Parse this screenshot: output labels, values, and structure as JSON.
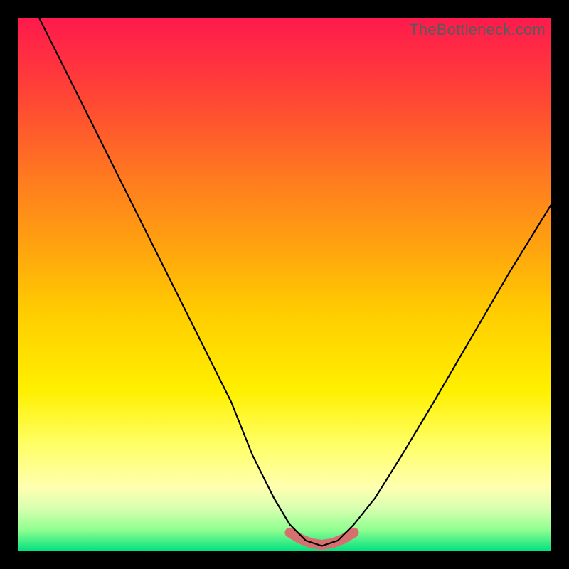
{
  "watermark": "TheBottleneck.com",
  "chart_data": {
    "type": "line",
    "title": "",
    "xlabel": "",
    "ylabel": "",
    "xlim": [
      0,
      100
    ],
    "ylim": [
      0,
      100
    ],
    "series": [
      {
        "name": "bottleneck-curve",
        "x": [
          4,
          10,
          16,
          22,
          28,
          34,
          40,
          44,
          48,
          51,
          54,
          57,
          60,
          63,
          67,
          72,
          78,
          85,
          92,
          100
        ],
        "values": [
          100,
          88,
          76,
          64,
          52,
          40,
          28,
          18,
          10,
          5,
          2,
          1,
          2,
          5,
          10,
          18,
          28,
          40,
          52,
          65
        ]
      },
      {
        "name": "highlight-band",
        "x": [
          51,
          53,
          55,
          57,
          59,
          61,
          63
        ],
        "values": [
          3.5,
          2.3,
          1.5,
          1.2,
          1.5,
          2.3,
          3.5
        ]
      }
    ],
    "colors": {
      "curve": "#000000",
      "highlight": "#d6706f",
      "gradient_top": "#ff1a4d",
      "gradient_bottom": "#00e080"
    }
  }
}
